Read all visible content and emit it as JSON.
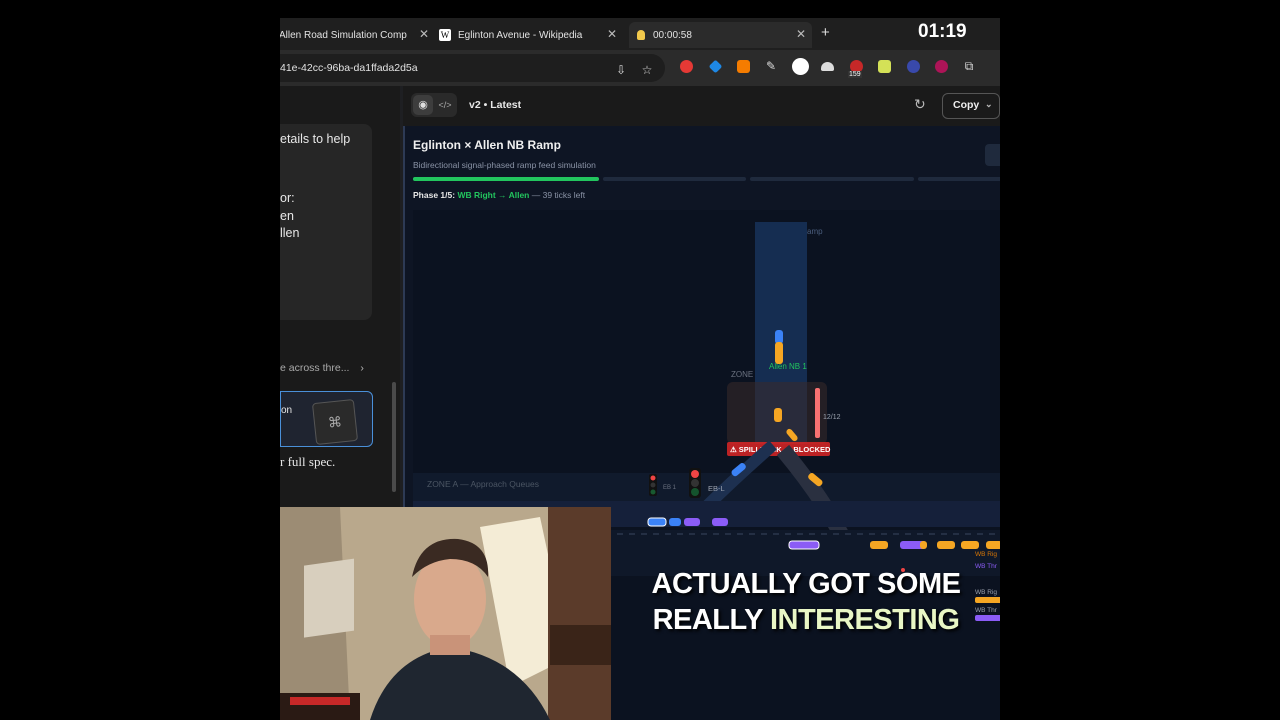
{
  "browser": {
    "tabs": [
      {
        "title": "Allen Road Simulation Complex",
        "active": false
      },
      {
        "title": "Eglinton Avenue - Wikipedia",
        "active": false
      },
      {
        "title": "00:00:58",
        "active": true
      }
    ],
    "url": "41e-42cc-96ba-da1ffada2d5a",
    "extension_badge": "159"
  },
  "recording_timer": "01:19",
  "chat": {
    "lines": [
      "etails to help",
      "or:",
      "en",
      "llen"
    ],
    "summary": "e across thre...",
    "artifact_label": "on",
    "footer": "r full spec."
  },
  "artifact": {
    "version": "v2 • Latest",
    "copy_label": "Copy"
  },
  "simulation": {
    "title": "Eglinton × Allen NB Ramp",
    "subtitle": "Bidirectional signal-phased ramp feed simulation",
    "phase": {
      "label": "Phase 1/5:",
      "name": "WB Right → Allen",
      "remaining": "— 39 ticks left",
      "progress_fraction": 1.0
    },
    "labels": {
      "ramp": "amp",
      "nb": "Allen NB 1",
      "zone": "ZONE",
      "count": "12/12",
      "spillback": "⚠ SPILLBACK — BLOCKED",
      "zone_a": "ZONE A — Approach Queues",
      "eb1": "EB 1",
      "ebl": "EB-L",
      "wb_right": "WB Rig",
      "wb_thru": "WB Thr",
      "wb_right2": "WB Rig",
      "wb_thru2": "WB Thr"
    }
  },
  "caption": {
    "line1": "ACTUALLY GOT SOME",
    "line2_plain": "REALLY ",
    "line2_highlight": "INTERESTING"
  },
  "colors": {
    "green": "#22c55e",
    "spillback_red": "#dc2626",
    "car_orange": "#f5a623",
    "car_purple": "#9b5de5",
    "car_blue": "#3b82f6"
  }
}
